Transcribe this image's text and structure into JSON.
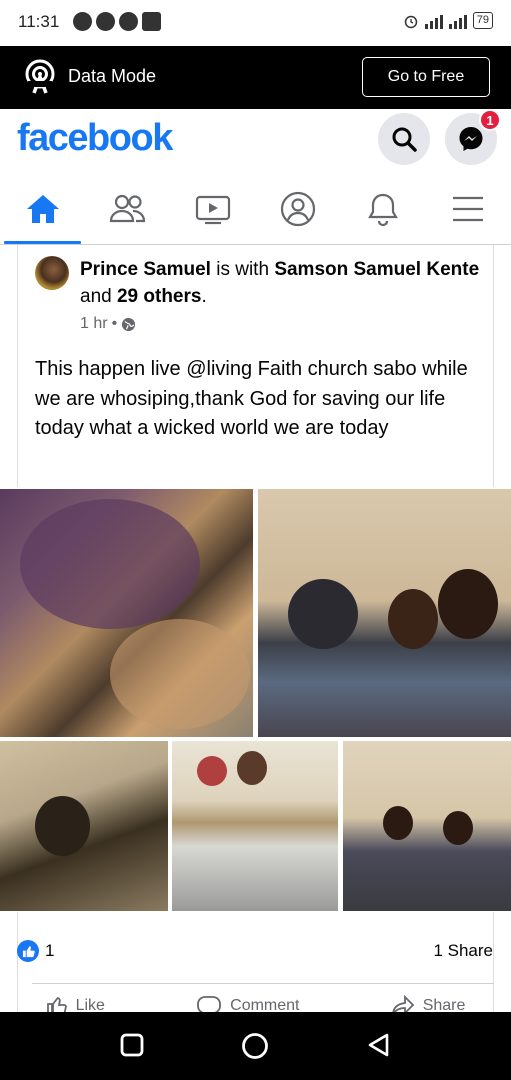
{
  "status_bar": {
    "time": "11:31",
    "battery": "79"
  },
  "data_mode": {
    "label": "Data Mode",
    "button": "Go to Free"
  },
  "header": {
    "logo": "facebook",
    "messenger_badge": "1"
  },
  "nav": {
    "items": [
      "home",
      "friends",
      "watch",
      "profile",
      "notifications",
      "menu"
    ],
    "active": "home"
  },
  "post": {
    "author": "Prince Samuel",
    "with_word": "is with",
    "tagged": "Samson Samuel Kente",
    "and_word": "and",
    "others": "29 others",
    "period": ".",
    "time": "1 hr",
    "privacy": "public-icon",
    "text": "This happen live @living Faith church sabo while we are whosiping,thank God for saving our life today what a wicked world we are today",
    "photo_count": 5
  },
  "reactions": {
    "likes": "1",
    "shares": "1 Share"
  },
  "actions": {
    "like": "Like",
    "comment": "Comment",
    "share": "Share"
  },
  "colors": {
    "brand": "#1877f2",
    "badge": "#e41e3f",
    "data_bar": "#000000"
  }
}
